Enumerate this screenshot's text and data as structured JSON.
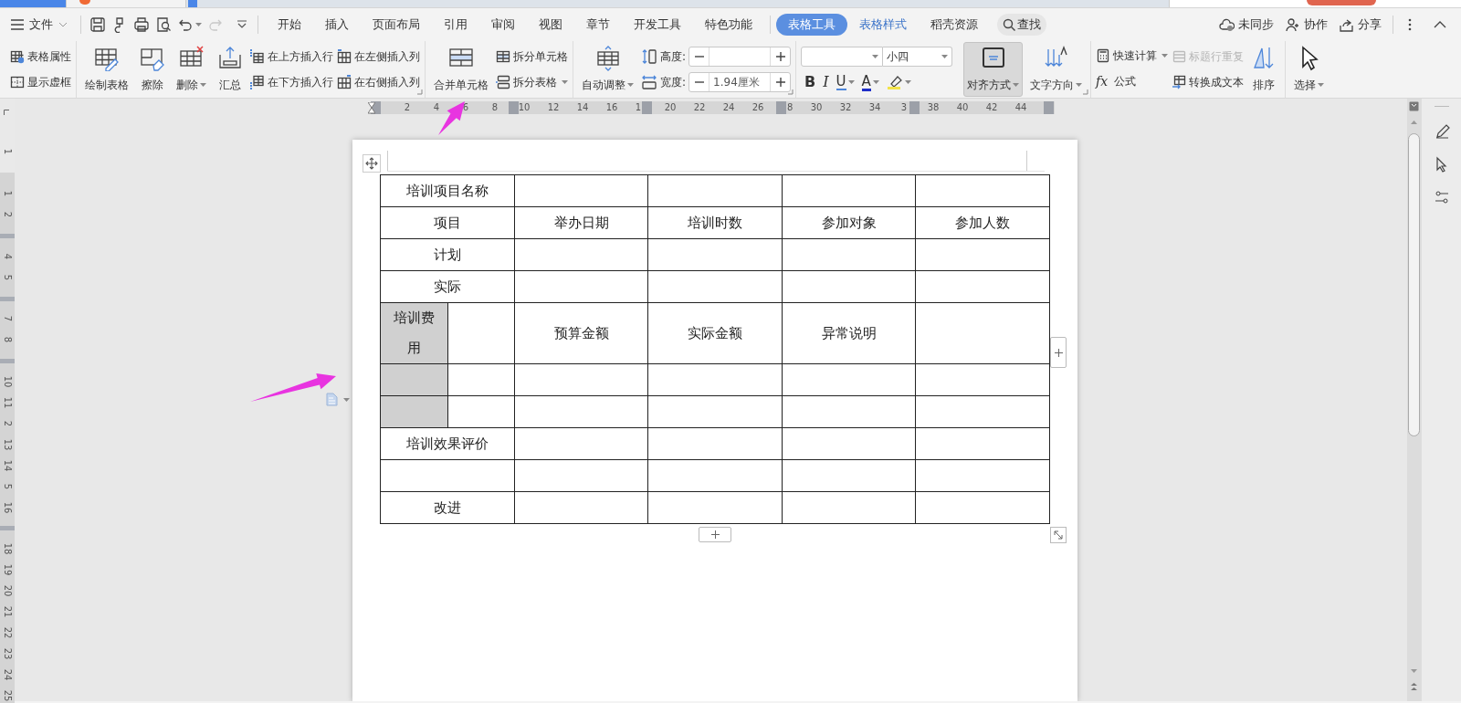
{
  "menu": {
    "file": "文件",
    "tabs": [
      {
        "label": "开始",
        "kind": "plain",
        "selected": false
      },
      {
        "label": "插入",
        "kind": "plain",
        "selected": false
      },
      {
        "label": "页面布局",
        "kind": "plain",
        "selected": false
      },
      {
        "label": "引用",
        "kind": "plain",
        "selected": false
      },
      {
        "label": "审阅",
        "kind": "plain",
        "selected": false
      },
      {
        "label": "视图",
        "kind": "plain",
        "selected": false
      },
      {
        "label": "章节",
        "kind": "plain",
        "selected": false
      },
      {
        "label": "开发工具",
        "kind": "plain",
        "selected": false
      },
      {
        "label": "特色功能",
        "kind": "plain",
        "selected": false
      },
      {
        "label": "表格工具",
        "kind": "context",
        "selected": true
      },
      {
        "label": "表格样式",
        "kind": "context",
        "selected": false
      },
      {
        "label": "稻壳资源",
        "kind": "plain",
        "selected": false
      }
    ],
    "search": "查找",
    "actions": [
      "未同步",
      "协作",
      "分享"
    ]
  },
  "ribbon": [
    {
      "sections": [
        {
          "kind": "stack",
          "rows": [
            {
              "label": "表格属性",
              "disabled": false,
              "dropdown": false
            },
            {
              "label": "显示虚框",
              "disabled": false,
              "dropdown": false
            }
          ]
        }
      ]
    },
    {
      "launcher": true,
      "sections": [
        {
          "kind": "large",
          "label": "绘制表格",
          "dropdown": false,
          "selected": false
        },
        {
          "kind": "large",
          "label": "擦除",
          "dropdown": false,
          "selected": false
        },
        {
          "kind": "large",
          "label": "删除",
          "dropdown": true,
          "selected": false
        },
        {
          "kind": "large",
          "label": "汇总",
          "dropdown": false,
          "selected": false
        },
        {
          "kind": "stack",
          "rows": [
            {
              "label": "在上方插入行",
              "disabled": false,
              "dropdown": false
            },
            {
              "label": "在下方插入行",
              "disabled": false,
              "dropdown": false
            }
          ]
        },
        {
          "kind": "stack",
          "rows": [
            {
              "label": "在左侧插入列",
              "disabled": false,
              "dropdown": false
            },
            {
              "label": "在右侧插入列",
              "disabled": false,
              "dropdown": false
            }
          ]
        }
      ]
    },
    {
      "sections": [
        {
          "kind": "large",
          "label": "合并单元格",
          "dropdown": false,
          "selected": false
        },
        {
          "kind": "stack",
          "rows": [
            {
              "label": "拆分单元格",
              "disabled": false,
              "dropdown": false
            },
            {
              "label": "拆分表格",
              "disabled": false,
              "dropdown": true
            }
          ]
        }
      ]
    },
    {
      "launcher": true,
      "sections": [
        {
          "kind": "large",
          "label": "自动调整",
          "dropdown": true,
          "selected": false
        },
        {
          "kind": "spin",
          "rows": [
            {
              "label": "高度:"
            },
            {
              "label": "宽度:",
              "value": "1.94厘米"
            }
          ]
        }
      ]
    },
    {
      "launcher": true,
      "sections": [
        {
          "kind": "font",
          "size": "小四",
          "buttons": [
            {
              "kind": "bold",
              "label": "B",
              "dropdown": false
            },
            {
              "kind": "italic",
              "label": "I",
              "dropdown": false
            },
            {
              "kind": "underline",
              "label": "U",
              "dropdown": true
            },
            {
              "kind": "color",
              "label": "A",
              "dropdown": true
            },
            {
              "kind": "highlight",
              "dropdown": true
            }
          ]
        },
        {
          "kind": "large",
          "label": "对齐方式",
          "dropdown": true,
          "selected": true
        },
        {
          "kind": "large",
          "label": "文字方向",
          "dropdown": true,
          "selected": false
        }
      ]
    },
    {
      "sections": [
        {
          "kind": "stack",
          "rows": [
            {
              "label": "快速计算",
              "disabled": false,
              "dropdown": true
            },
            {
              "label": "公式",
              "glyph": "fx",
              "disabled": false,
              "dropdown": false
            }
          ]
        },
        {
          "kind": "stack",
          "rows": [
            {
              "label": "标题行重复",
              "disabled": true,
              "dropdown": false
            },
            {
              "label": "转换成文本",
              "disabled": false,
              "dropdown": false
            }
          ]
        },
        {
          "kind": "large",
          "label": "排序",
          "dropdown": false,
          "selected": false
        }
      ]
    },
    {
      "sections": [
        {
          "kind": "large",
          "label": "选择",
          "dropdown": true,
          "selected": false
        }
      ]
    }
  ],
  "ruler": {
    "horizontal": [
      "2",
      "4",
      "6",
      "8",
      "10",
      "12",
      "14",
      "16",
      "1",
      "20",
      "22",
      "24",
      "26",
      "8",
      "30",
      "32",
      "34",
      "3",
      "38",
      "40",
      "42",
      "44"
    ],
    "vertical": [
      "1",
      "1",
      "2",
      "4",
      "5",
      "7",
      "8",
      "10",
      "11",
      "2",
      "13",
      "14",
      "5",
      "16",
      "18",
      "19",
      "20",
      "21",
      "22",
      "23",
      "24",
      "25"
    ]
  },
  "table": {
    "rows": [
      {
        "cells": [
          {
            "kind": "wide",
            "text": "培训项目名称",
            "selected": false
          },
          {
            "kind": "merged"
          },
          {
            "kind": "cell",
            "selected": false
          },
          {
            "kind": "cell",
            "selected": false
          },
          {
            "kind": "cell",
            "selected": false
          },
          {
            "kind": "cell",
            "selected": false
          }
        ]
      },
      {
        "cells": [
          {
            "kind": "wide",
            "text": "项目",
            "selected": false
          },
          {
            "kind": "merged"
          },
          {
            "kind": "cell",
            "text": "举办日期",
            "selected": false
          },
          {
            "kind": "cell",
            "text": "培训时数",
            "selected": false
          },
          {
            "kind": "cell",
            "text": "参加对象",
            "selected": false
          },
          {
            "kind": "cell",
            "text": "参加人数",
            "selected": false
          }
        ]
      },
      {
        "cells": [
          {
            "kind": "wide",
            "text": "计划",
            "selected": false
          },
          {
            "kind": "merged"
          },
          {
            "kind": "cell",
            "selected": false
          },
          {
            "kind": "cell",
            "selected": false
          },
          {
            "kind": "cell",
            "selected": false
          },
          {
            "kind": "cell",
            "selected": false
          }
        ]
      },
      {
        "cells": [
          {
            "kind": "wide",
            "text": "实际",
            "selected": false
          },
          {
            "kind": "merged"
          },
          {
            "kind": "cell",
            "selected": false
          },
          {
            "kind": "cell",
            "selected": false
          },
          {
            "kind": "cell",
            "selected": false
          },
          {
            "kind": "cell",
            "selected": false
          }
        ]
      },
      {
        "cells": [
          {
            "kind": "cell",
            "text": "培训费用",
            "selected": true
          },
          {
            "kind": "cell",
            "selected": false
          },
          {
            "kind": "cell",
            "text": "预算金额",
            "selected": false
          },
          {
            "kind": "cell",
            "text": "实际金额",
            "selected": false
          },
          {
            "kind": "cell",
            "text": "异常说明",
            "selected": false
          },
          {
            "kind": "cell",
            "selected": false
          }
        ]
      },
      {
        "cells": [
          {
            "kind": "cell",
            "selected": true
          },
          {
            "kind": "cell",
            "selected": false
          },
          {
            "kind": "cell",
            "selected": false
          },
          {
            "kind": "cell",
            "selected": false
          },
          {
            "kind": "cell",
            "selected": false
          },
          {
            "kind": "cell",
            "selected": false
          }
        ]
      },
      {
        "cells": [
          {
            "kind": "cell",
            "selected": true
          },
          {
            "kind": "cell",
            "selected": false
          },
          {
            "kind": "cell",
            "selected": false
          },
          {
            "kind": "cell",
            "selected": false
          },
          {
            "kind": "cell",
            "selected": false
          },
          {
            "kind": "cell",
            "selected": false
          }
        ]
      },
      {
        "cells": [
          {
            "kind": "wide",
            "text": "培训效果评价",
            "selected": false
          },
          {
            "kind": "merged"
          },
          {
            "kind": "cell",
            "selected": false
          },
          {
            "kind": "cell",
            "selected": false
          },
          {
            "kind": "cell",
            "selected": false
          },
          {
            "kind": "cell",
            "selected": false
          }
        ]
      },
      {
        "cells": [
          {
            "kind": "wide",
            "selected": false
          },
          {
            "kind": "merged"
          },
          {
            "kind": "cell",
            "selected": false
          },
          {
            "kind": "cell",
            "selected": false
          },
          {
            "kind": "cell",
            "selected": false
          },
          {
            "kind": "cell",
            "selected": false
          }
        ]
      },
      {
        "cells": [
          {
            "kind": "wide",
            "text": "改进",
            "selected": false
          },
          {
            "kind": "merged"
          },
          {
            "kind": "cell",
            "selected": false
          },
          {
            "kind": "cell",
            "selected": false
          },
          {
            "kind": "cell",
            "selected": false
          },
          {
            "kind": "cell",
            "selected": false
          }
        ]
      }
    ]
  },
  "annotations": [
    {
      "kind": "arrow"
    },
    {
      "kind": "arrow"
    }
  ]
}
